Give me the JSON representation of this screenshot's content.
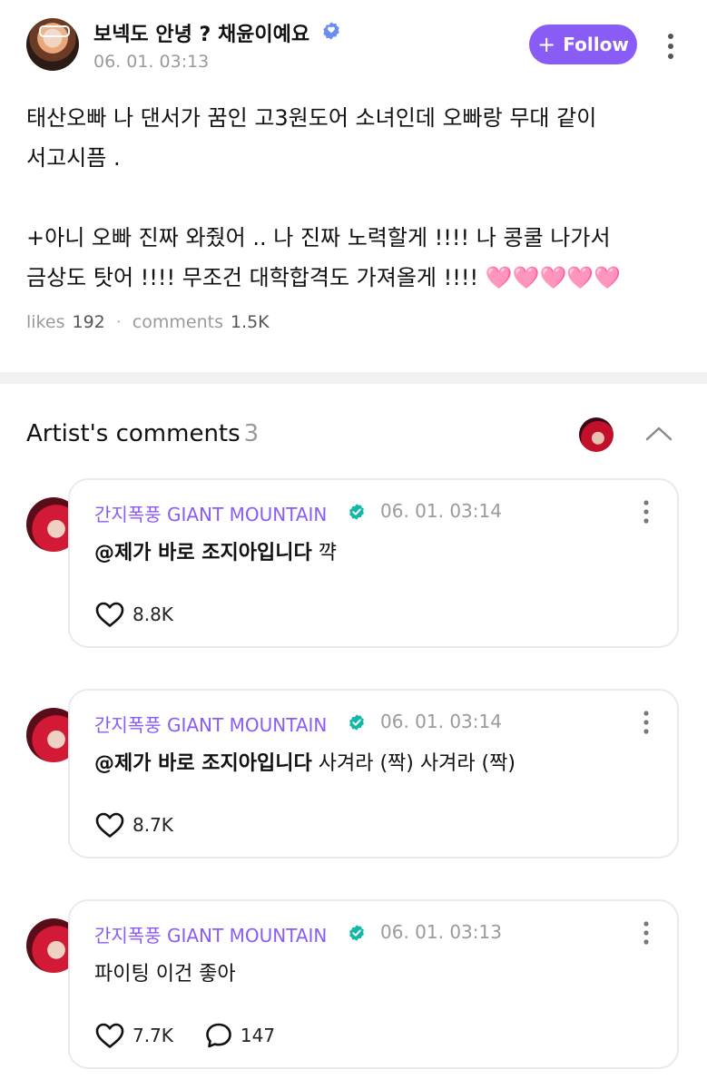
{
  "post": {
    "author": "보넥도 안녕 ? 채윤이예요",
    "time": "06. 01. 03:13",
    "follow_label": "Follow",
    "body_lines": [
      "태산오빠 나 댄서가 꿈인 고3원도어 소녀인데 오빠랑 무대 같이",
      "서고시픔 .",
      "",
      "+아니 오빠 진짜 와줬어 .. 나 진짜 노력할게 !!!! 나 콩쿨 나가서",
      "금상도 탓어 !!!! 무조건 대학합격도 가져올게 !!!! "
    ],
    "hearts": "🩷🩷🩷🩷🩷",
    "likes_label": "likes",
    "likes": "192",
    "comments_label": "comments",
    "comments": "1.5K"
  },
  "artist_comments": {
    "title": "Artist's comments",
    "count": "3",
    "items": [
      {
        "author": "간지폭풍 GIANT MOUNTAIN",
        "time": "06. 01. 03:14",
        "mention": "@제가 바로 조지아입니다",
        "text": " 꺅",
        "likes": "8.8K",
        "replies": ""
      },
      {
        "author": "간지폭풍 GIANT MOUNTAIN",
        "time": "06. 01. 03:14",
        "mention": "@제가 바로 조지아입니다",
        "text": " 사겨라 (짝) 사겨라 (짝)",
        "likes": "8.7K",
        "replies": ""
      },
      {
        "author": "간지폭풍 GIANT MOUNTAIN",
        "time": "06. 01. 03:13",
        "mention": "",
        "text": "파이팅 이건 좋아",
        "likes": "7.7K",
        "replies": "147"
      }
    ]
  },
  "colors": {
    "accent": "#8a5cf6",
    "verified": "#0fb8a8",
    "heart_emoji": "#ff7bc0",
    "muted": "#9a9a9a"
  },
  "icons": [
    "verified-badge-icon",
    "more-vertical-icon",
    "chevron-up-icon",
    "heart-icon",
    "comment-bubble-icon",
    "plus-icon"
  ]
}
